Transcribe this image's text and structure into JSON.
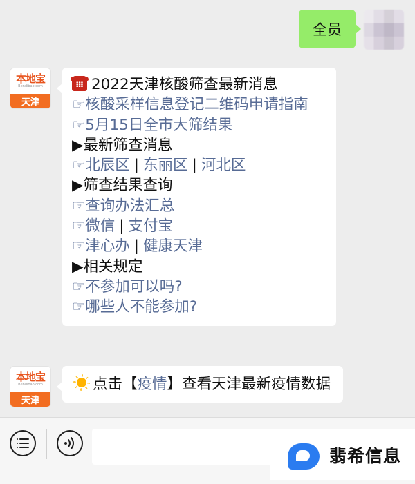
{
  "outgoing_message": {
    "text": "全员"
  },
  "message1": {
    "avatar": {
      "name": "本地宝",
      "url": "Bendibao.com",
      "city": "天津"
    },
    "title_icon": "telephone-icon",
    "title": "2022天津核酸筛查最新消息",
    "hand_glyph": "☞",
    "arrow_glyph": "▶",
    "link_qrcode": "核酸采样信息登记二维码申请指南",
    "link_result_0515": "5月15日全市大筛结果",
    "section_latest": "最新筛查消息",
    "districts": [
      "北辰区",
      "东丽区",
      "河北区"
    ],
    "section_query": "筛查结果查询",
    "link_query_methods": "查询办法汇总",
    "query_apps_1": [
      "微信",
      "支付宝"
    ],
    "query_apps_2": [
      "津心办",
      "健康天津"
    ],
    "section_rules": "相关规定",
    "link_faq_1": "不参加可以吗?",
    "link_faq_2": "哪些人不能参加?",
    "separator": "|"
  },
  "message2": {
    "avatar": {
      "name": "本地宝",
      "url": "Bendibao.com",
      "city": "天津"
    },
    "icon": "sun-icon",
    "text_before": "点击【",
    "link": "疫情",
    "text_after": "】查看天津最新疫情数据"
  },
  "input_bar": {
    "menu_icon": "menu-icon",
    "voice_icon": "voice-icon",
    "placeholder": ""
  },
  "watermark": {
    "text": "翡希信息"
  },
  "colors": {
    "background": "#ededed",
    "outgoing_bubble": "#95ec69",
    "link": "#576b95",
    "logo_orange": "#f26d21"
  }
}
